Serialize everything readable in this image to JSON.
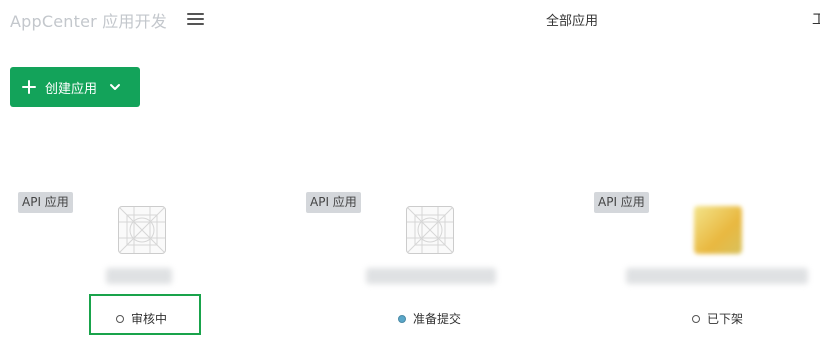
{
  "header": {
    "brand": "AppCenter 应用开发",
    "center_title": "全部应用",
    "right_edge_text": "工"
  },
  "toolbar": {
    "create_label": "创建应用"
  },
  "cards": [
    {
      "type_badge": "API 应用",
      "status": "审核中",
      "status_dot": "hollow"
    },
    {
      "type_badge": "API 应用",
      "status": "准备提交",
      "status_dot": "filled"
    },
    {
      "type_badge": "API 应用",
      "status": "已下架",
      "status_dot": "hollow"
    }
  ],
  "colors": {
    "accent": "#13a35a",
    "focus": "#19a34b",
    "badge_bg": "#d4d7db",
    "status_blue": "#5aa7c9"
  },
  "icons": [
    "menu-icon",
    "plus-icon",
    "chevron-down-icon",
    "app-placeholder-icon"
  ]
}
